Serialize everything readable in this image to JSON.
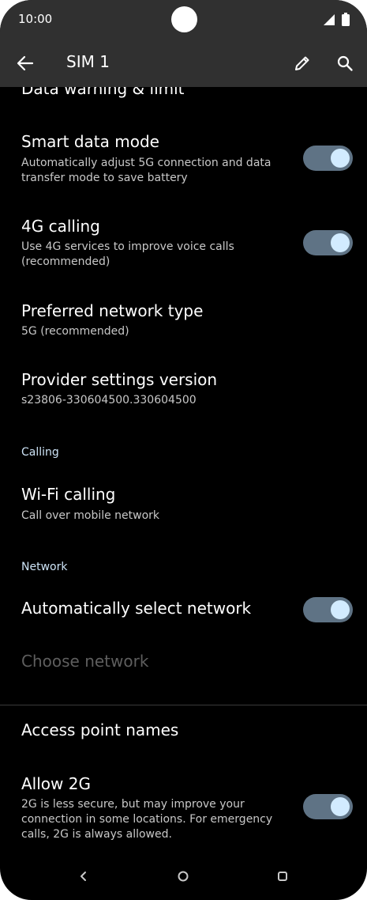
{
  "status_bar": {
    "time": "10:00",
    "icons": [
      "signal-icon",
      "battery-icon"
    ]
  },
  "app_bar": {
    "title": "SIM 1",
    "actions": [
      "back-arrow-icon",
      "edit-pencil-icon",
      "search-icon"
    ]
  },
  "settings": {
    "data_warning": {
      "title": "Data warning & limit"
    },
    "smart_data_mode": {
      "title": "Smart data mode",
      "subtitle": "Automatically adjust 5G connection and data transfer mode to save battery",
      "enabled": true
    },
    "calling_4g": {
      "title": "4G calling",
      "subtitle": "Use 4G services to improve voice calls (recommended)",
      "enabled": true
    },
    "preferred_network": {
      "title": "Preferred network type",
      "subtitle": "5G (recommended)"
    },
    "provider_settings": {
      "title": "Provider settings version",
      "subtitle": "s23806-330604500.330604500"
    },
    "calling_header": "Calling",
    "wifi_calling": {
      "title": "Wi-Fi calling",
      "subtitle": "Call over mobile network"
    },
    "network_header": "Network",
    "auto_select_network": {
      "title": "Automatically select network",
      "enabled": true
    },
    "choose_network": {
      "title": "Choose network",
      "disabled": true
    },
    "access_point_names": {
      "title": "Access point names"
    },
    "allow_2g": {
      "title": "Allow 2G",
      "subtitle": "2G is less secure, but may improve your connection in some locations. For emergency calls, 2G is always allowed.",
      "enabled": true
    }
  },
  "nav_bar": {
    "buttons": [
      "nav-back-icon",
      "nav-home-icon",
      "nav-recents-icon"
    ]
  },
  "colors": {
    "background": "#000000",
    "app_bar": "#303030",
    "section_header": "#cde3f6",
    "toggle_track": "#5f7385",
    "toggle_knob": "#d2ebff",
    "disabled_text": "#5e5e5e"
  }
}
